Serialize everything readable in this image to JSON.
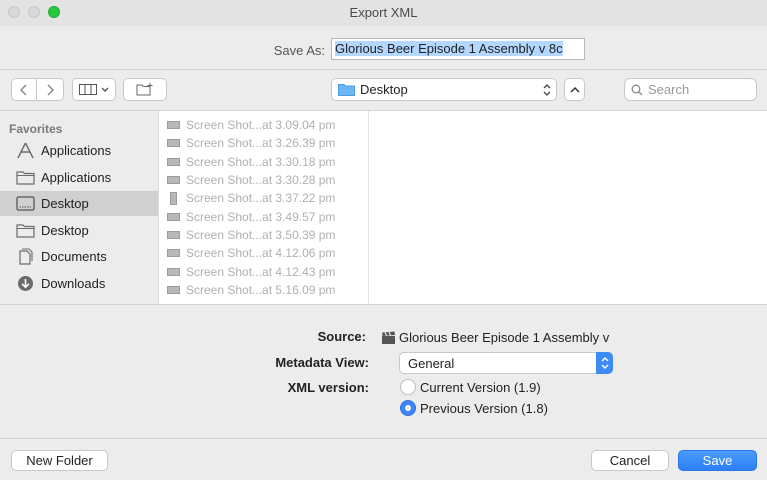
{
  "window": {
    "title": "Export XML"
  },
  "save_as": {
    "label": "Save As:",
    "value": "Glorious Beer Episode 1 Assembly v 8c"
  },
  "toolbar": {
    "location": "Desktop",
    "search_placeholder": "Search"
  },
  "sidebar": {
    "heading": "Favorites",
    "items": [
      {
        "label": "Applications",
        "icon": "applications-icon"
      },
      {
        "label": "Applications",
        "icon": "folder-icon"
      },
      {
        "label": "Desktop",
        "icon": "desktop-icon",
        "selected": true
      },
      {
        "label": "Desktop",
        "icon": "folder-icon"
      },
      {
        "label": "Documents",
        "icon": "documents-icon"
      },
      {
        "label": "Downloads",
        "icon": "downloads-icon"
      }
    ]
  },
  "files": [
    "Screen Shot...at 3.09.04 pm",
    "Screen Shot...at 3.26.39 pm",
    "Screen Shot...at 3.30.18 pm",
    "Screen Shot...at 3.30.28 pm",
    "Screen Shot...at 3.37.22 pm",
    "Screen Shot...at 3.49.57 pm",
    "Screen Shot...at 3.50.39 pm",
    "Screen Shot...at 4.12.06 pm",
    "Screen Shot...at 4.12.43 pm",
    "Screen Shot...at 5.16.09 pm"
  ],
  "options": {
    "source_label": "Source:",
    "source_value": "Glorious Beer Episode 1 Assembly v",
    "metadata_label": "Metadata View:",
    "metadata_value": "General",
    "xml_label": "XML version:",
    "xml_options": [
      {
        "label": "Current Version (1.9)",
        "selected": false
      },
      {
        "label": "Previous Version (1.8)",
        "selected": true
      }
    ]
  },
  "buttons": {
    "new_folder": "New Folder",
    "cancel": "Cancel",
    "save": "Save"
  },
  "colors": {
    "accent": "#3b86f7",
    "selection": "#b3d7ff"
  }
}
